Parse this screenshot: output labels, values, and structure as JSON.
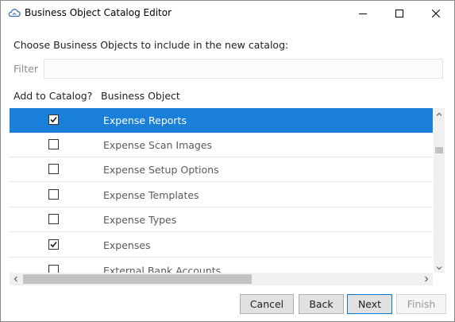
{
  "window": {
    "title": "Business Object Catalog Editor",
    "icons": {
      "app": "cloud-icon",
      "minimize": "minimize-icon",
      "maximize": "maximize-icon",
      "close": "close-icon"
    }
  },
  "prompt": "Choose Business Objects to include in the new catalog:",
  "filter": {
    "label": "Filter",
    "value": "",
    "placeholder": ""
  },
  "columns": {
    "add": "Add to Catalog?",
    "object": "Business Object"
  },
  "rows": [
    {
      "label": "Expense Reports",
      "checked": true,
      "selected": true
    },
    {
      "label": "Expense Scan Images",
      "checked": false,
      "selected": false
    },
    {
      "label": "Expense Setup Options",
      "checked": false,
      "selected": false
    },
    {
      "label": "Expense Templates",
      "checked": false,
      "selected": false
    },
    {
      "label": "Expense Types",
      "checked": false,
      "selected": false
    },
    {
      "label": "Expenses",
      "checked": true,
      "selected": false
    },
    {
      "label": "External Bank Accounts",
      "checked": false,
      "selected": false
    }
  ],
  "buttons": {
    "cancel": "Cancel",
    "back": "Back",
    "next": "Next",
    "finish": "Finish"
  },
  "colors": {
    "selection": "#1a7fd9",
    "default_button_border": "#0078d7",
    "app_icon": "#3a6fb0"
  }
}
